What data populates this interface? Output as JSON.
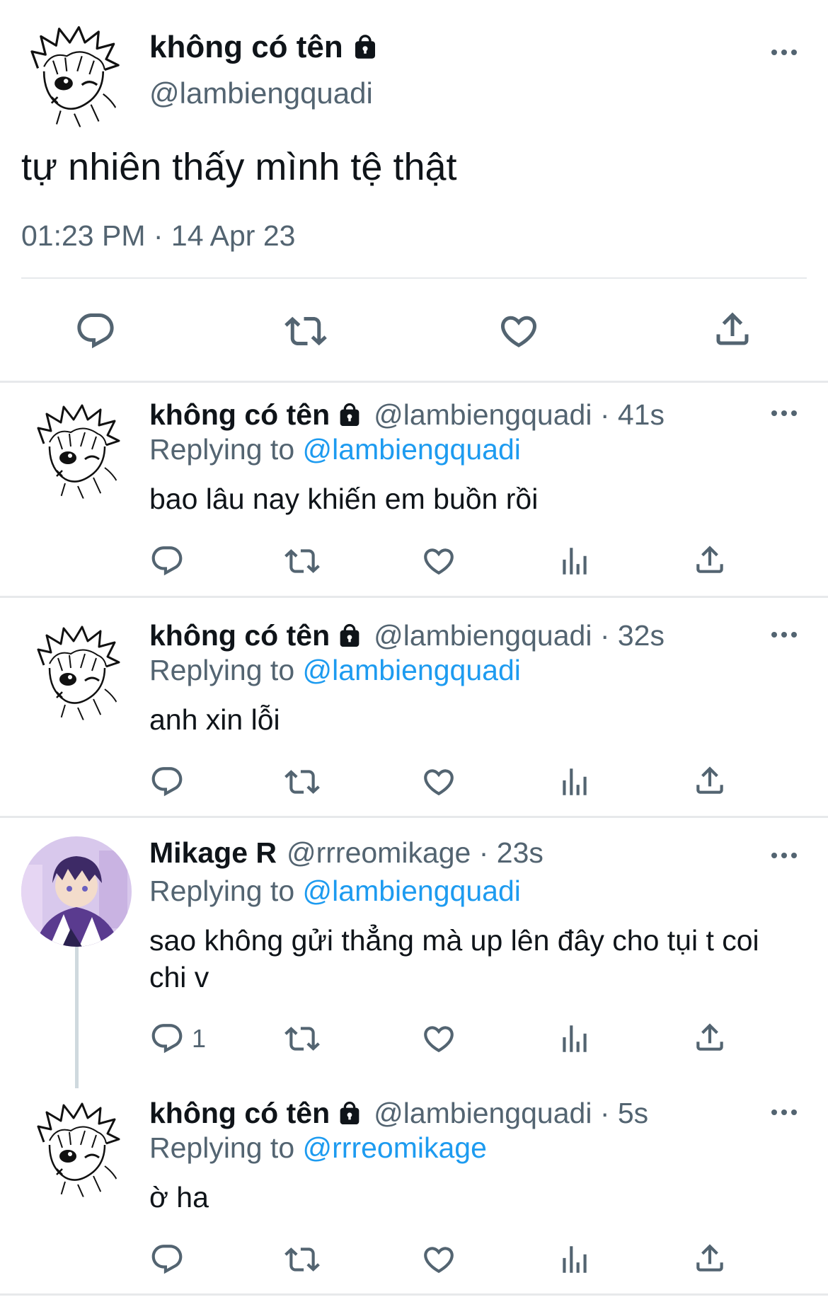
{
  "main_tweet": {
    "display_name": "không có tên",
    "handle": "@lambiengquadi",
    "text": "tự nhiên thấy mình tệ thật",
    "timestamp": "01:23 PM · 14 Apr 23",
    "actions": [
      "reply-icon",
      "retweet-icon",
      "like-icon",
      "share-icon"
    ]
  },
  "replies": [
    {
      "display_name": "không có tên",
      "handle_time": "@lambiengquadi · 41s",
      "replying_prefix": "Replying to",
      "replying_to": "@lambiengquadi",
      "text": "bao lâu nay khiến em buồn rồi"
    },
    {
      "display_name": "không có tên",
      "handle_time": "@lambiengquadi · 32s",
      "replying_prefix": "Replying to",
      "replying_to": "@lambiengquadi",
      "text": "anh xin lỗi"
    },
    {
      "display_name": "Mikage R",
      "handle_time": "@rrreomikage · 23s",
      "replying_prefix": "Replying to",
      "replying_to": "@lambiengquadi",
      "text": "sao không gửi thẳng mà up lên đây cho tụi t coi chi v",
      "reply_count": "1"
    },
    {
      "display_name": "không có tên",
      "handle_time": "@lambiengquadi · 5s",
      "replying_prefix": "Replying to",
      "replying_to": "@rrreomikage",
      "text": "ờ ha"
    }
  ],
  "colors": {
    "text": "#0f1419",
    "secondary": "#536471",
    "link": "#1d9bf0",
    "divider": "#e7e9eb",
    "thread_line": "#cfd9de"
  }
}
